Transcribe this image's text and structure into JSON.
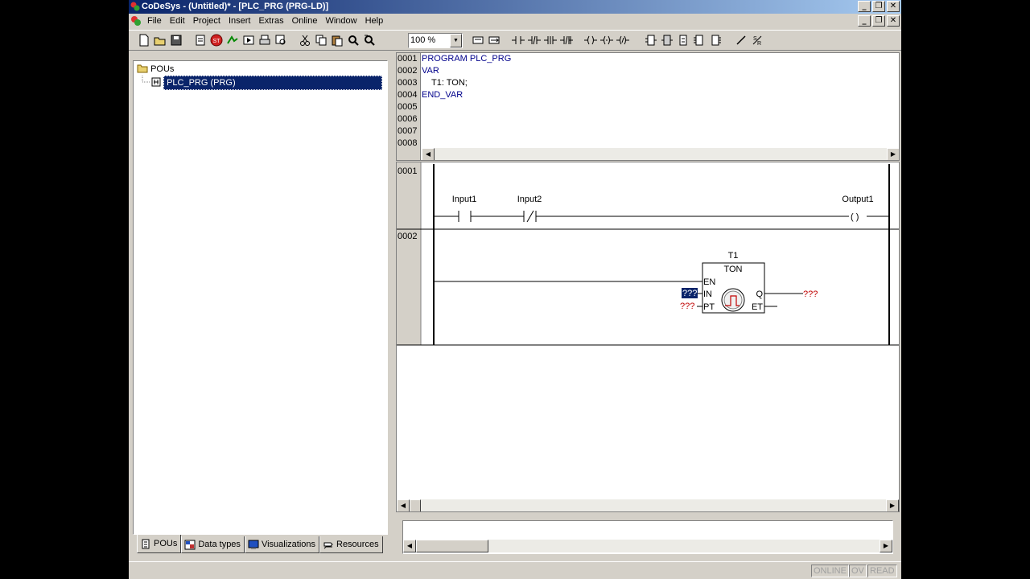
{
  "window": {
    "title": "CoDeSys - (Untitled)* - [PLC_PRG (PRG-LD)]",
    "buttons": {
      "minimize": "_",
      "maximize": "❐",
      "close": "✕"
    }
  },
  "menu": {
    "items": [
      "File",
      "Edit",
      "Project",
      "Insert",
      "Extras",
      "Online",
      "Window",
      "Help"
    ]
  },
  "toolbar": {
    "zoom_value": "100 %",
    "zoom_arrow": "▼"
  },
  "tree": {
    "root_label": "POUs",
    "item_label": "PLC_PRG (PRG)"
  },
  "tabs": [
    "POUs",
    "Data types",
    "Visualizations",
    "Resources"
  ],
  "declaration": {
    "line_numbers": [
      "0001",
      "0002",
      "0003",
      "0004",
      "0005",
      "0006",
      "0007",
      "0008"
    ],
    "lines": [
      "PROGRAM PLC_PRG",
      "VAR",
      "    T1: TON;",
      "END_VAR",
      "",
      "",
      "",
      ""
    ]
  },
  "ladder": {
    "networks": [
      "0001",
      "0002"
    ],
    "contacts": [
      "Input1",
      "Input2"
    ],
    "coil": "Output1",
    "coil_symbol": "( )",
    "block": {
      "instance": "T1",
      "type": "TON",
      "inputs": [
        "EN",
        "IN",
        "PT"
      ],
      "outputs": [
        "Q",
        "ET"
      ],
      "in_value": "???",
      "pt_value": "???",
      "q_value": "???"
    }
  },
  "statusbar": {
    "items": [
      "ONLINE",
      "OV",
      "READ"
    ]
  },
  "colors": {
    "title_start": "#0a246a",
    "title_end": "#a6caf0",
    "selection": "#0a246a",
    "code_blue": "#00008b",
    "placeholder_red": "#c00000"
  }
}
